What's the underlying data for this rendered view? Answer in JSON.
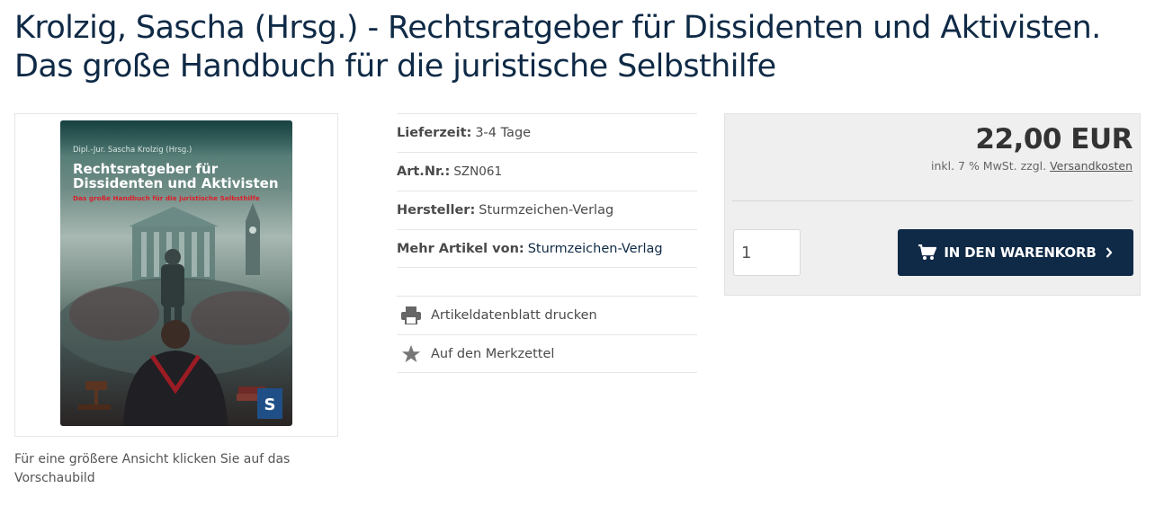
{
  "product": {
    "title": "Krolzig, Sascha (Hrsg.) - Rechtsratgeber für Dissidenten und Aktivisten. Das große Handbuch für die juristische Selbsthilfe",
    "cover": {
      "author": "Dipl.-Jur. Sascha Krolzig (Hrsg.)",
      "title": "Rechtsratgeber für Dissidenten und Aktivisten",
      "subtitle": "Das große Handbuch für die juristische Selbsthilfe"
    },
    "image_caption": "Für eine größere Ansicht klicken Sie auf das Vorschaubild"
  },
  "details": [
    {
      "label": "Lieferzeit:",
      "value": "3-4 Tage"
    },
    {
      "label": "Art.Nr.:",
      "value": "SZN061"
    },
    {
      "label": "Hersteller:",
      "value": "Sturmzeichen-Verlag"
    },
    {
      "label": "Mehr Artikel von:",
      "value": "Sturmzeichen-Verlag"
    }
  ],
  "actions": {
    "print": {
      "label": "Artikeldatenblatt drucken",
      "icon": "printer-icon"
    },
    "wishlist": {
      "label": "Auf den Merkzettel",
      "icon": "star-icon"
    }
  },
  "buy": {
    "price": "22,00 EUR",
    "tax_prefix": "inkl. 7 % MwSt. zzgl.",
    "shipping_link": "Versandkosten",
    "quantity": "1",
    "cart_button": "IN DEN WARENKORB"
  },
  "colors": {
    "brand_navy": "#0f2a46",
    "buybox_bg": "#efefef",
    "cover_accent": "#d8202a"
  }
}
